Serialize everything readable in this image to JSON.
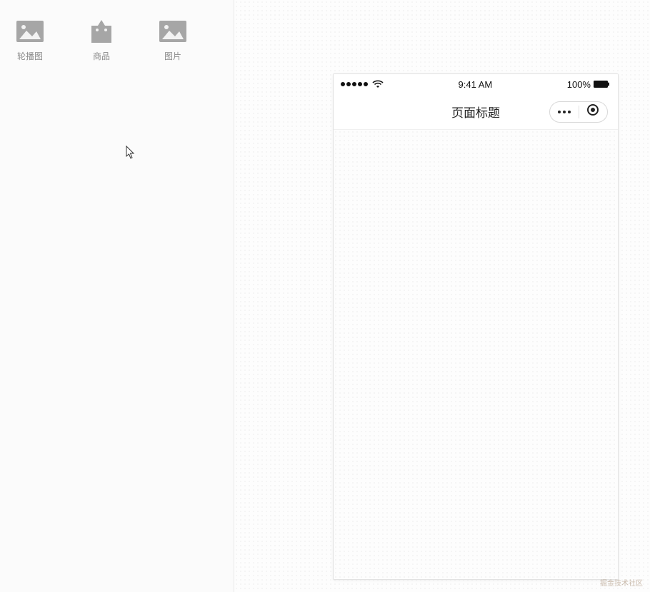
{
  "sidebar": {
    "components": [
      {
        "name": "carousel-component",
        "label": "轮播图",
        "icon": "image-icon"
      },
      {
        "name": "goods-component",
        "label": "商品",
        "icon": "bag-icon"
      },
      {
        "name": "image-component",
        "label": "图片",
        "icon": "image-icon"
      }
    ]
  },
  "phone": {
    "status": {
      "time": "9:41 AM",
      "battery": "100%"
    },
    "nav": {
      "title": "页面标题"
    }
  },
  "watermark": "掘金技术社区"
}
